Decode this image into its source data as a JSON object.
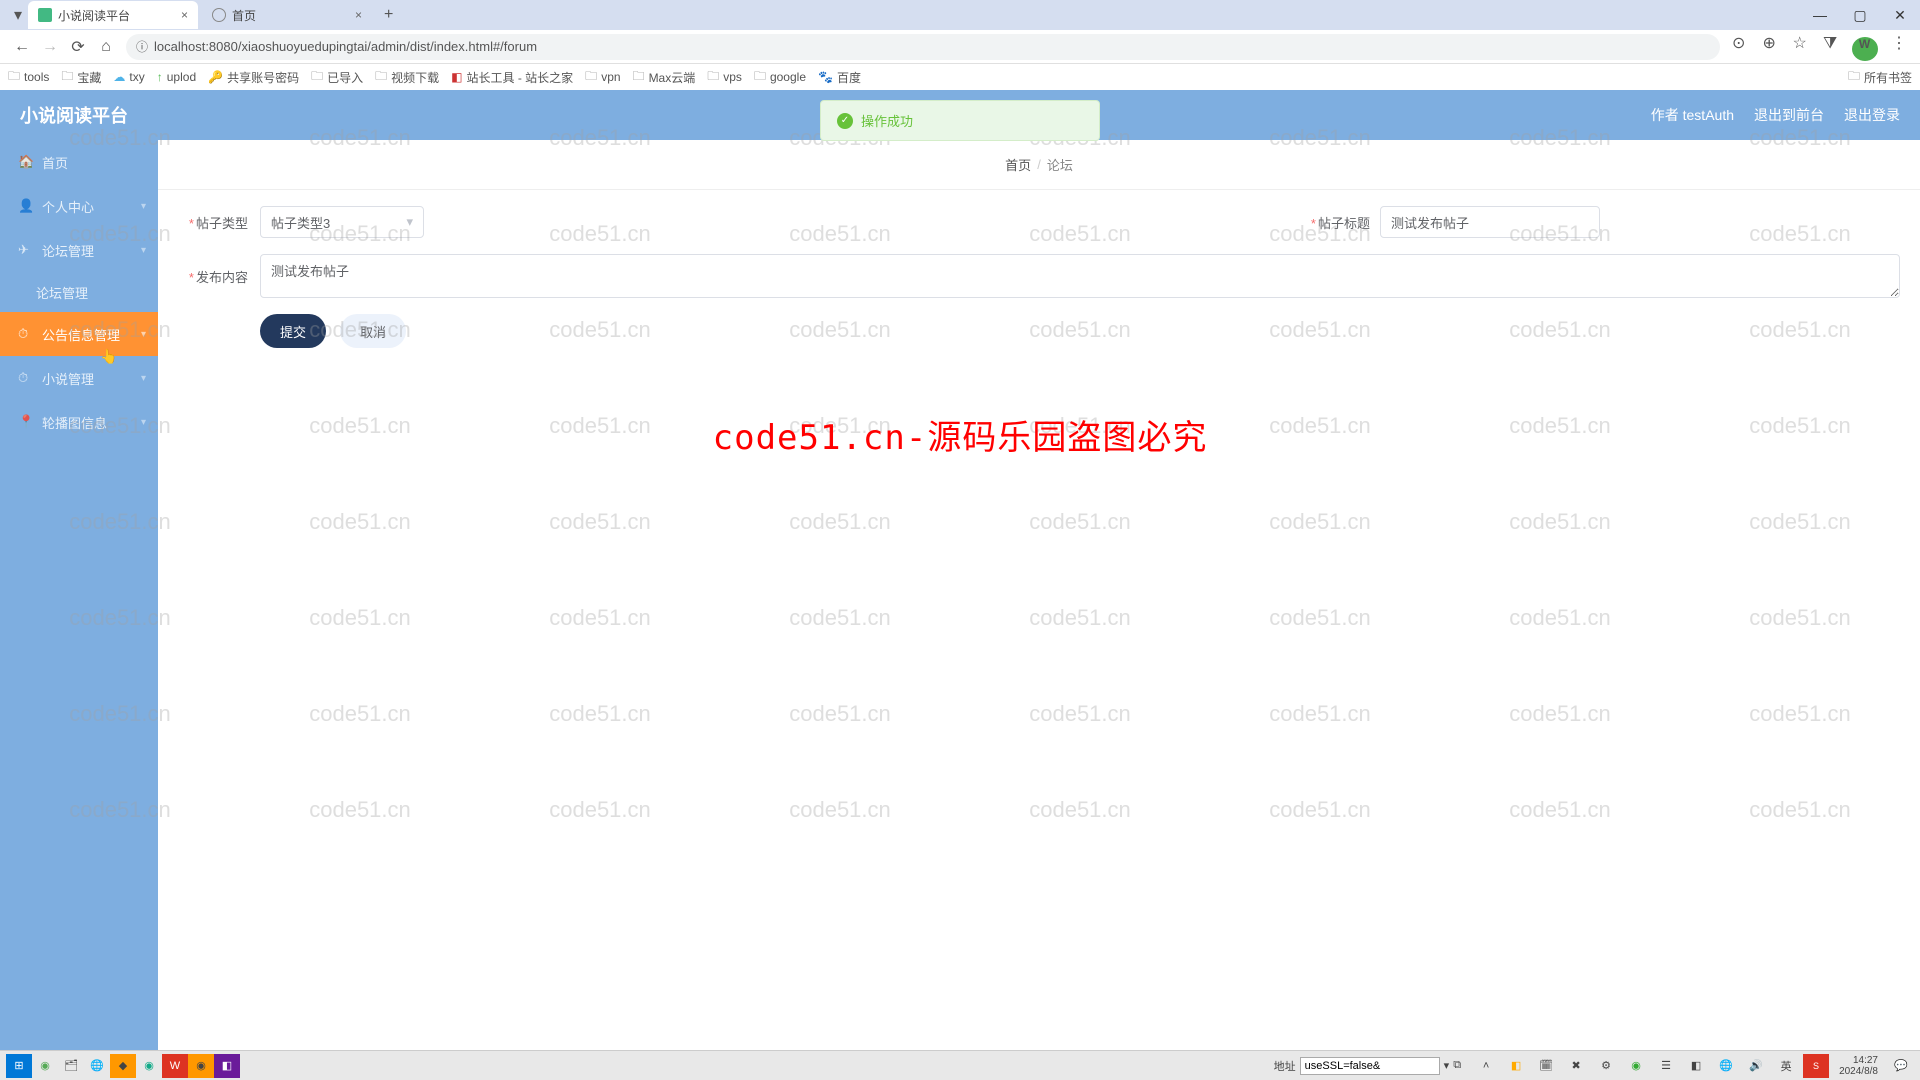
{
  "browser": {
    "tabs": [
      {
        "title": "小说阅读平台",
        "active": true
      },
      {
        "title": "首页",
        "active": false
      }
    ],
    "url": "localhost:8080/xiaoshuoyuedupingtai/admin/dist/index.html#/forum",
    "bookmarks": [
      "tools",
      "宝藏",
      "txy",
      "uplod",
      "共享账号密码",
      "已导入",
      "视频下载",
      "站长工具 - 站长之家",
      "vpn",
      "Max云端",
      "vps",
      "google",
      "百度"
    ],
    "all_bookmarks": "所有书签",
    "avatar_letter": "W"
  },
  "header": {
    "title": "小说阅读平台",
    "user_label": "作者 testAuth",
    "logout_front": "退出到前台",
    "logout": "退出登录"
  },
  "toast": {
    "text": "操作成功"
  },
  "sidebar": {
    "items": [
      {
        "icon": "🏠",
        "label": "首页"
      },
      {
        "icon": "👤",
        "label": "个人中心",
        "arrow": true
      },
      {
        "icon": "✈",
        "label": "论坛管理",
        "arrow": true
      },
      {
        "icon": "",
        "label": "论坛管理",
        "sub": true
      },
      {
        "icon": "⏱",
        "label": "公告信息管理",
        "arrow": true,
        "active": true
      },
      {
        "icon": "⏱",
        "label": "小说管理",
        "arrow": true
      },
      {
        "icon": "📍",
        "label": "轮播图信息",
        "arrow": true
      }
    ]
  },
  "breadcrumb": {
    "home": "首页",
    "current": "论坛"
  },
  "form": {
    "type_label": "帖子类型",
    "type_value": "帖子类型3",
    "title_label": "帖子标题",
    "title_value": "测试发布帖子",
    "content_label": "发布内容",
    "content_value": "测试发布帖子",
    "submit": "提交",
    "cancel": "取消"
  },
  "watermark": {
    "text": "code51.cn",
    "big": "code51.cn-源码乐园盗图必究"
  },
  "taskbar": {
    "addr_label": "地址",
    "addr_value": "useSSL=false&",
    "ime": "英",
    "time": "14:27",
    "date": "2024/8/8"
  }
}
